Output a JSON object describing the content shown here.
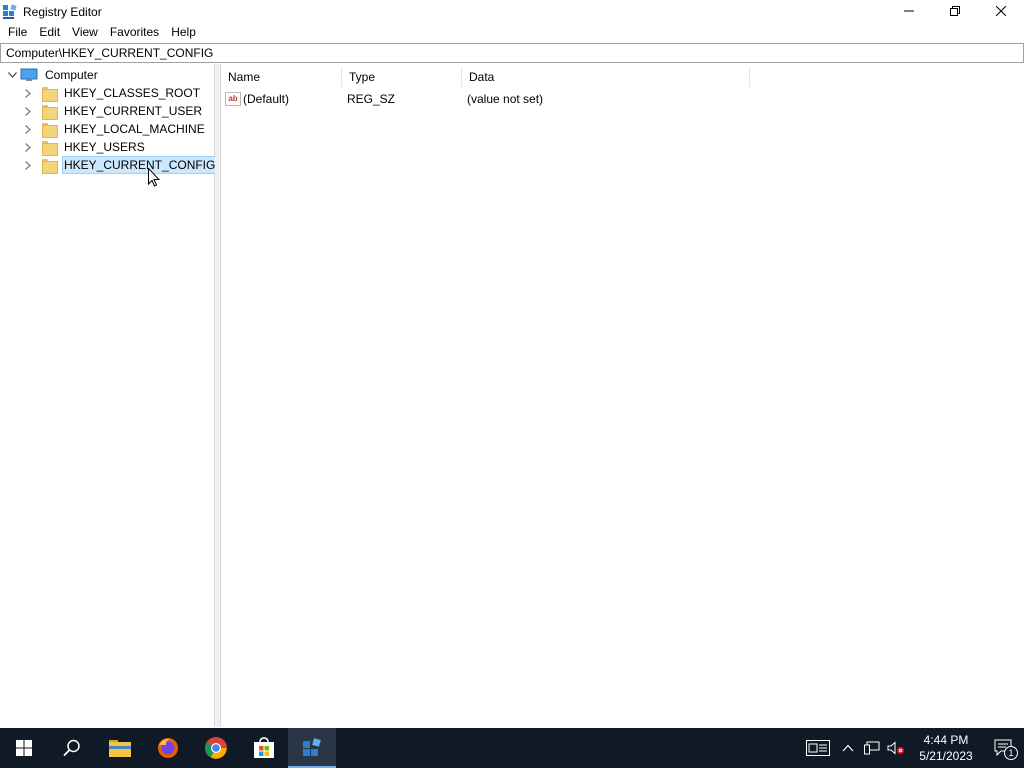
{
  "window": {
    "title": "Registry Editor"
  },
  "menu": [
    "File",
    "Edit",
    "View",
    "Favorites",
    "Help"
  ],
  "address": "Computer\\HKEY_CURRENT_CONFIG",
  "tree": {
    "root": "Computer",
    "items": [
      {
        "label": "HKEY_CLASSES_ROOT",
        "selected": false
      },
      {
        "label": "HKEY_CURRENT_USER",
        "selected": false
      },
      {
        "label": "HKEY_LOCAL_MACHINE",
        "selected": false
      },
      {
        "label": "HKEY_USERS",
        "selected": false
      },
      {
        "label": "HKEY_CURRENT_CONFIG",
        "selected": true
      }
    ]
  },
  "list": {
    "columns": [
      "Name",
      "Type",
      "Data"
    ],
    "rows": [
      {
        "name": "(Default)",
        "type": "REG_SZ",
        "data": "(value not set)"
      }
    ]
  },
  "taskbar": {
    "clock_time": "4:44 PM",
    "clock_date": "5/21/2023",
    "notification_count": "1"
  },
  "colors": {
    "selection_bg": "#cce8ff",
    "taskbar_bg": "#101a26",
    "accent": "#0078d7"
  }
}
